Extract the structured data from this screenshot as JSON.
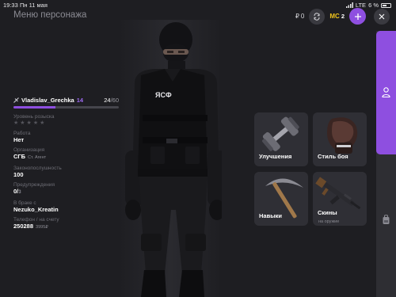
{
  "status": {
    "time": "19:33",
    "date": "Пн 11 мая",
    "network": "LTE",
    "battery": "6 %"
  },
  "header": {
    "title": "Меню персонажа"
  },
  "topbar": {
    "rubles": "0",
    "mc_label": "MC",
    "mc_value": "2"
  },
  "player": {
    "name": "Vladislav_Grechka",
    "level": "14",
    "xp_current": "24",
    "xp_max": "/60",
    "xp_fraction": 0.4
  },
  "info": {
    "wanted_label": "Уровень розыска",
    "wanted_stars": "★★★★★",
    "job_label": "Работа",
    "job_value": "Нет",
    "org_label": "Организация",
    "org_value": "СГБ",
    "org_rank": "Ст. Агент",
    "law_label": "Законопослушность",
    "law_value": "100",
    "warn_label": "Предупреждения",
    "warn_value": "0/",
    "warn_max": "3",
    "married_label": "В браке с",
    "married_value": "Nezuko_Kreatin",
    "phone_label": "Телефон / на счету",
    "phone_value": "250288",
    "phone_balance": "3995₽"
  },
  "character": {
    "vest_text": "ЯСФ"
  },
  "cards": {
    "upgrades": "Улучшения",
    "fight_style": "Стиль боя",
    "skills": "Навыки",
    "skins": "Скины",
    "skins_sub": "на оружие"
  },
  "colors": {
    "accent": "#8e4fe0",
    "gold": "#f0c41b",
    "background": "#1e1e22",
    "card": "#2f2f35"
  }
}
